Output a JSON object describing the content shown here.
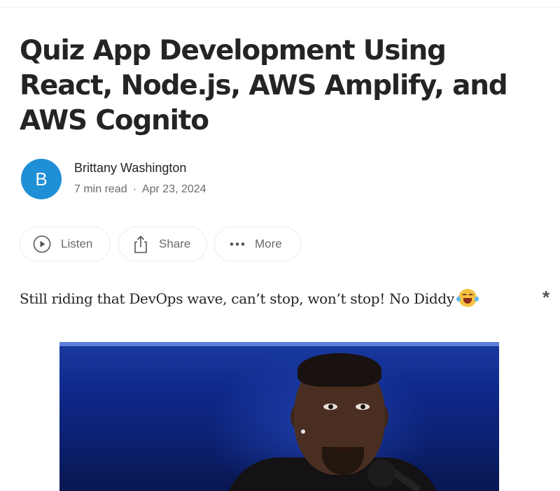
{
  "article": {
    "title": "Quiz App Development Using React, Node.js, AWS Amplify, and AWS Cognito",
    "author": {
      "initial": "B",
      "name": "Brittany Washington",
      "avatar_color": "#1f8fd6"
    },
    "read_time": "7 min read",
    "separator": "·",
    "date": "Apr 23, 2024",
    "actions": {
      "listen": "Listen",
      "share": "Share",
      "more": "More"
    },
    "intro": "Still riding that DevOps wave, can’t stop, won’t stop! No Diddy",
    "intro_emoji": "face-with-tears-of-joy-icon",
    "side_marker": "*"
  },
  "colors": {
    "text": "#242424",
    "muted": "#6b6b6b",
    "pill_border": "#ebebeb"
  }
}
